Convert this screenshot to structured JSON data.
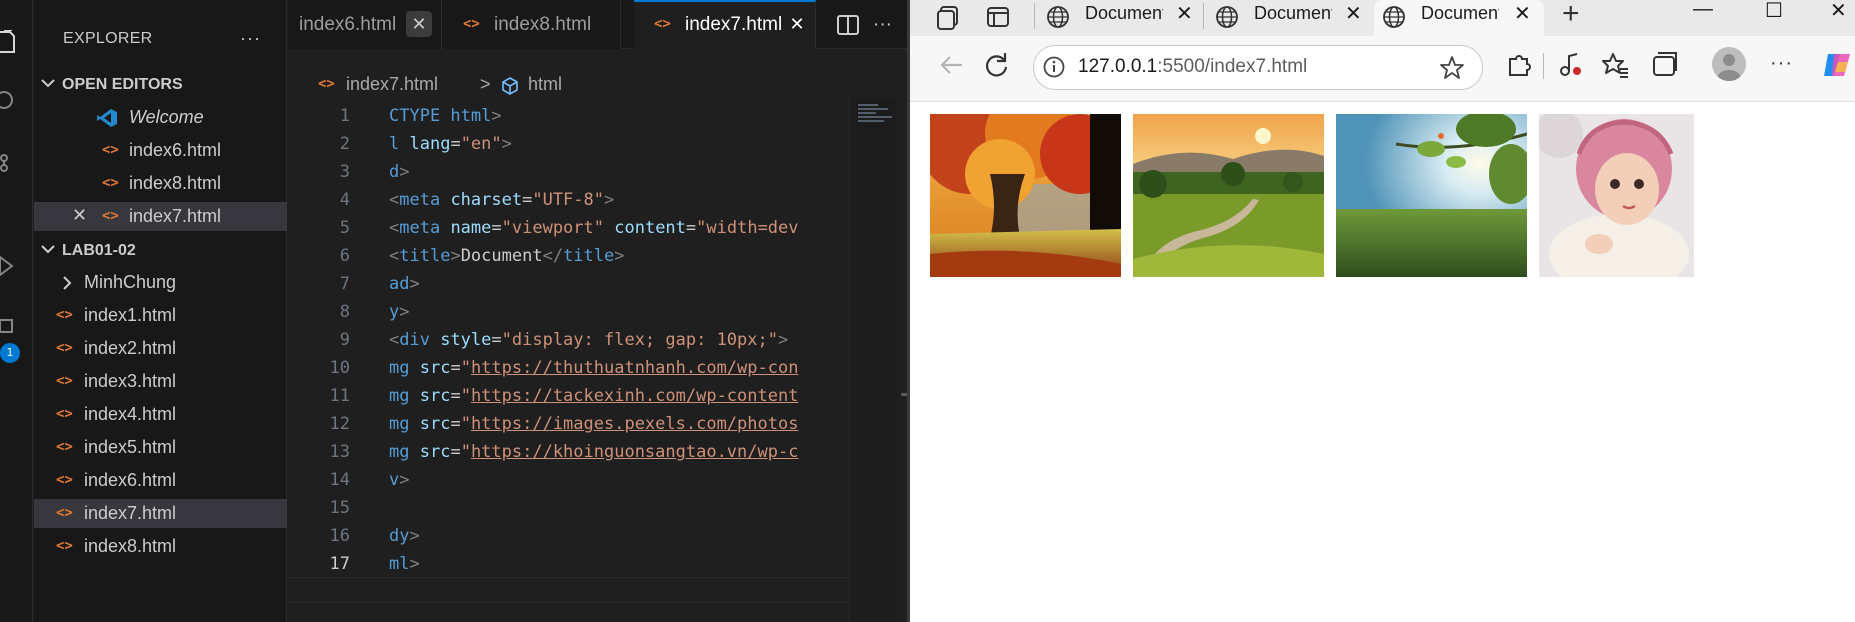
{
  "vscode": {
    "explorer_title": "EXPLORER",
    "more_label": "···",
    "badge_count": "1",
    "open_editors": {
      "title": "OPEN EDITORS",
      "items": [
        {
          "label": "Welcome",
          "icon": "vscode-logo-icon"
        },
        {
          "label": "index6.html",
          "icon": "html-file-icon"
        },
        {
          "label": "index8.html",
          "icon": "html-file-icon"
        },
        {
          "label": "index7.html",
          "icon": "html-file-icon",
          "active": true,
          "close": "✕"
        }
      ]
    },
    "workspace": {
      "title": "LAB01-02",
      "folder": "MinhChung",
      "files": [
        "index1.html",
        "index2.html",
        "index3.html",
        "index4.html",
        "index5.html",
        "index6.html",
        "index7.html",
        "index8.html"
      ]
    },
    "tabs": [
      {
        "label": "index6.html",
        "close": "✕"
      },
      {
        "label": "index8.html",
        "close": ""
      },
      {
        "label": "index7.html",
        "close": "✕",
        "active": true
      }
    ],
    "tab_actions": {
      "split": "split-editor-icon",
      "more": "···"
    },
    "breadcrumb": {
      "file": "index7.html",
      "sep": ">",
      "symbol": "html"
    },
    "code_lines": [
      {
        "n": "1",
        "text": "CTYPE html>"
      },
      {
        "n": "2",
        "text": "l lang=\"en\">"
      },
      {
        "n": "3",
        "text": "d>"
      },
      {
        "n": "4",
        "text": "<meta charset=\"UTF-8\">"
      },
      {
        "n": "5",
        "text": "<meta name=\"viewport\" content=\"width=dev"
      },
      {
        "n": "6",
        "text": "<title>Document</title>"
      },
      {
        "n": "7",
        "text": "ad>"
      },
      {
        "n": "8",
        "text": "y>"
      },
      {
        "n": "9",
        "text": "<div style=\"display: flex; gap: 10px;\">"
      },
      {
        "n": "10",
        "text": "mg src=\"https://thuthuatnhanh.com/wp-con"
      },
      {
        "n": "11",
        "text": "mg src=\"https://tackexinh.com/wp-content"
      },
      {
        "n": "12",
        "text": "mg src=\"https://images.pexels.com/photos"
      },
      {
        "n": "13",
        "text": "mg src=\"https://khoinguonsangtao.vn/wp-c"
      },
      {
        "n": "14",
        "text": "v>"
      },
      {
        "n": "15",
        "text": ""
      },
      {
        "n": "16",
        "text": "dy>"
      },
      {
        "n": "17",
        "text": "ml>"
      }
    ]
  },
  "browser": {
    "tabs": [
      {
        "label": "Document",
        "close": "✕"
      },
      {
        "label": "Document",
        "close": "✕"
      },
      {
        "label": "Document",
        "close": "✕",
        "active": true
      }
    ],
    "new_tab": "+",
    "window": {
      "minimize": "—",
      "maximize": "☐",
      "close": "✕"
    },
    "url_host": "127.0.0.1",
    "url_path": ":5500/index7.html",
    "more": "···",
    "images": [
      {
        "name": "autumn-tree-photo"
      },
      {
        "name": "countryside-path-photo"
      },
      {
        "name": "sunlit-branch-photo"
      },
      {
        "name": "baby-in-pink-bonnet-photo"
      }
    ]
  },
  "colors": {
    "accent": "#0078d4",
    "html_icon": "#e37933",
    "tag": "#569cd6",
    "attr": "#9cdcfe",
    "string": "#ce9178"
  }
}
